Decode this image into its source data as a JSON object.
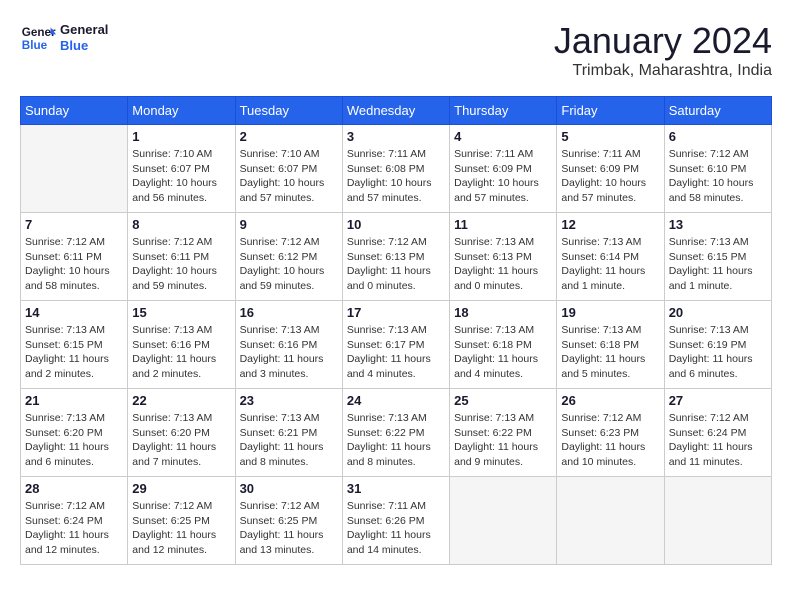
{
  "header": {
    "logo_general": "General",
    "logo_blue": "Blue",
    "month_title": "January 2024",
    "location": "Trimbak, Maharashtra, India"
  },
  "weekdays": [
    "Sunday",
    "Monday",
    "Tuesday",
    "Wednesday",
    "Thursday",
    "Friday",
    "Saturday"
  ],
  "weeks": [
    [
      {
        "day": "",
        "info": ""
      },
      {
        "day": "1",
        "info": "Sunrise: 7:10 AM\nSunset: 6:07 PM\nDaylight: 10 hours\nand 56 minutes."
      },
      {
        "day": "2",
        "info": "Sunrise: 7:10 AM\nSunset: 6:07 PM\nDaylight: 10 hours\nand 57 minutes."
      },
      {
        "day": "3",
        "info": "Sunrise: 7:11 AM\nSunset: 6:08 PM\nDaylight: 10 hours\nand 57 minutes."
      },
      {
        "day": "4",
        "info": "Sunrise: 7:11 AM\nSunset: 6:09 PM\nDaylight: 10 hours\nand 57 minutes."
      },
      {
        "day": "5",
        "info": "Sunrise: 7:11 AM\nSunset: 6:09 PM\nDaylight: 10 hours\nand 57 minutes."
      },
      {
        "day": "6",
        "info": "Sunrise: 7:12 AM\nSunset: 6:10 PM\nDaylight: 10 hours\nand 58 minutes."
      }
    ],
    [
      {
        "day": "7",
        "info": "Sunrise: 7:12 AM\nSunset: 6:11 PM\nDaylight: 10 hours\nand 58 minutes."
      },
      {
        "day": "8",
        "info": "Sunrise: 7:12 AM\nSunset: 6:11 PM\nDaylight: 10 hours\nand 59 minutes."
      },
      {
        "day": "9",
        "info": "Sunrise: 7:12 AM\nSunset: 6:12 PM\nDaylight: 10 hours\nand 59 minutes."
      },
      {
        "day": "10",
        "info": "Sunrise: 7:12 AM\nSunset: 6:13 PM\nDaylight: 11 hours\nand 0 minutes."
      },
      {
        "day": "11",
        "info": "Sunrise: 7:13 AM\nSunset: 6:13 PM\nDaylight: 11 hours\nand 0 minutes."
      },
      {
        "day": "12",
        "info": "Sunrise: 7:13 AM\nSunset: 6:14 PM\nDaylight: 11 hours\nand 1 minute."
      },
      {
        "day": "13",
        "info": "Sunrise: 7:13 AM\nSunset: 6:15 PM\nDaylight: 11 hours\nand 1 minute."
      }
    ],
    [
      {
        "day": "14",
        "info": "Sunrise: 7:13 AM\nSunset: 6:15 PM\nDaylight: 11 hours\nand 2 minutes."
      },
      {
        "day": "15",
        "info": "Sunrise: 7:13 AM\nSunset: 6:16 PM\nDaylight: 11 hours\nand 2 minutes."
      },
      {
        "day": "16",
        "info": "Sunrise: 7:13 AM\nSunset: 6:16 PM\nDaylight: 11 hours\nand 3 minutes."
      },
      {
        "day": "17",
        "info": "Sunrise: 7:13 AM\nSunset: 6:17 PM\nDaylight: 11 hours\nand 4 minutes."
      },
      {
        "day": "18",
        "info": "Sunrise: 7:13 AM\nSunset: 6:18 PM\nDaylight: 11 hours\nand 4 minutes."
      },
      {
        "day": "19",
        "info": "Sunrise: 7:13 AM\nSunset: 6:18 PM\nDaylight: 11 hours\nand 5 minutes."
      },
      {
        "day": "20",
        "info": "Sunrise: 7:13 AM\nSunset: 6:19 PM\nDaylight: 11 hours\nand 6 minutes."
      }
    ],
    [
      {
        "day": "21",
        "info": "Sunrise: 7:13 AM\nSunset: 6:20 PM\nDaylight: 11 hours\nand 6 minutes."
      },
      {
        "day": "22",
        "info": "Sunrise: 7:13 AM\nSunset: 6:20 PM\nDaylight: 11 hours\nand 7 minutes."
      },
      {
        "day": "23",
        "info": "Sunrise: 7:13 AM\nSunset: 6:21 PM\nDaylight: 11 hours\nand 8 minutes."
      },
      {
        "day": "24",
        "info": "Sunrise: 7:13 AM\nSunset: 6:22 PM\nDaylight: 11 hours\nand 8 minutes."
      },
      {
        "day": "25",
        "info": "Sunrise: 7:13 AM\nSunset: 6:22 PM\nDaylight: 11 hours\nand 9 minutes."
      },
      {
        "day": "26",
        "info": "Sunrise: 7:12 AM\nSunset: 6:23 PM\nDaylight: 11 hours\nand 10 minutes."
      },
      {
        "day": "27",
        "info": "Sunrise: 7:12 AM\nSunset: 6:24 PM\nDaylight: 11 hours\nand 11 minutes."
      }
    ],
    [
      {
        "day": "28",
        "info": "Sunrise: 7:12 AM\nSunset: 6:24 PM\nDaylight: 11 hours\nand 12 minutes."
      },
      {
        "day": "29",
        "info": "Sunrise: 7:12 AM\nSunset: 6:25 PM\nDaylight: 11 hours\nand 12 minutes."
      },
      {
        "day": "30",
        "info": "Sunrise: 7:12 AM\nSunset: 6:25 PM\nDaylight: 11 hours\nand 13 minutes."
      },
      {
        "day": "31",
        "info": "Sunrise: 7:11 AM\nSunset: 6:26 PM\nDaylight: 11 hours\nand 14 minutes."
      },
      {
        "day": "",
        "info": ""
      },
      {
        "day": "",
        "info": ""
      },
      {
        "day": "",
        "info": ""
      }
    ]
  ]
}
